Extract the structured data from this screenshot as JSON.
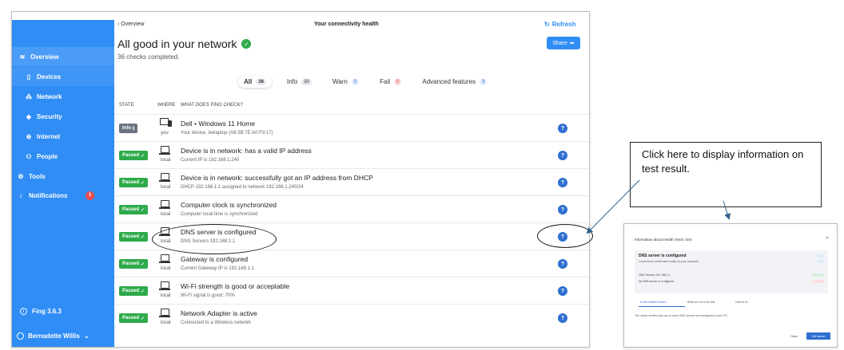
{
  "sidebar": {
    "items": [
      {
        "label": "Overview",
        "icon": "wifi-icon"
      },
      {
        "label": "Devices",
        "icon": "phone-icon"
      },
      {
        "label": "Network",
        "icon": "network-icon"
      },
      {
        "label": "Security",
        "icon": "shield-icon"
      },
      {
        "label": "Internet",
        "icon": "globe-icon"
      },
      {
        "label": "People",
        "icon": "people-icon"
      },
      {
        "label": "Tools",
        "icon": "tools-icon"
      },
      {
        "label": "Notifications",
        "icon": "bell-icon",
        "badge": "1"
      }
    ],
    "version": "Fing 3.6.3",
    "user": "Bernadette Willis"
  },
  "header": {
    "breadcrumb": "Overview",
    "title": "Your connectivity health",
    "refresh_label": "Refresh",
    "heading": "All good in your network",
    "subheading": "36 checks completed.",
    "share_label": "Share"
  },
  "filters": [
    {
      "label": "All",
      "count": "36"
    },
    {
      "label": "Info",
      "count": "30"
    },
    {
      "label": "Warn",
      "count": "0"
    },
    {
      "label": "Fail",
      "count": "0"
    },
    {
      "label": "Advanced features",
      "count": "3"
    }
  ],
  "columns": {
    "state": "STATE",
    "where": "WHERE",
    "what": "WHAT DOES FING CHECK?"
  },
  "rows": [
    {
      "status": "Info",
      "where": "you",
      "title": "Dell • Windows 11 Home",
      "sub": "Your device, bwlaptop (A8:3B:7E:A0:F9:17)"
    },
    {
      "status": "Passed",
      "where": "local",
      "title": "Device is in network: has a valid IP address",
      "sub": "Current IP is 192.168.1.240"
    },
    {
      "status": "Passed",
      "where": "local",
      "title": "Device is in network: successfully got an IP address from DHCP",
      "sub": "DHCP 192.168.1.1 assigned to network 192.168.1.240/24"
    },
    {
      "status": "Passed",
      "where": "local",
      "title": "Computer clock is synchronized",
      "sub": "Computer local time is synchronized"
    },
    {
      "status": "Passed",
      "where": "local",
      "title": "DNS server is configured",
      "sub": "DNS Servers 192.168.1.1"
    },
    {
      "status": "Passed",
      "where": "local",
      "title": "Gateway is configured",
      "sub": "Current Gateway IP is 192.168.1.1"
    },
    {
      "status": "Passed",
      "where": "local",
      "title": "Wi-Fi strength is good or acceptable",
      "sub": "Wi-Fi signal is good: 70%"
    },
    {
      "status": "Passed",
      "where": "local",
      "title": "Network Adapter is active",
      "sub": "Connected to a Wireless network"
    }
  ],
  "callout": "Click here to display information on test result.",
  "popup": {
    "title": "Information about health check: DIS",
    "heading": "DNS server is configured",
    "sub": "Local check: performed locally on your computer",
    "line1": "DNS Servers 192.168.1.1",
    "line2": "No DNS server is configured",
    "tabs": [
      "Is this critical/ broken",
      "What do I do to fix this",
      "How to fix"
    ],
    "desc": "The check verifies that one or more DNS servers are configured in your PC.",
    "close_label": "Close",
    "share_label": "Get advice"
  },
  "colors": {
    "sidebar": "#2f8df5",
    "passed": "#2eaa4a",
    "accent": "#2f6fd0"
  }
}
